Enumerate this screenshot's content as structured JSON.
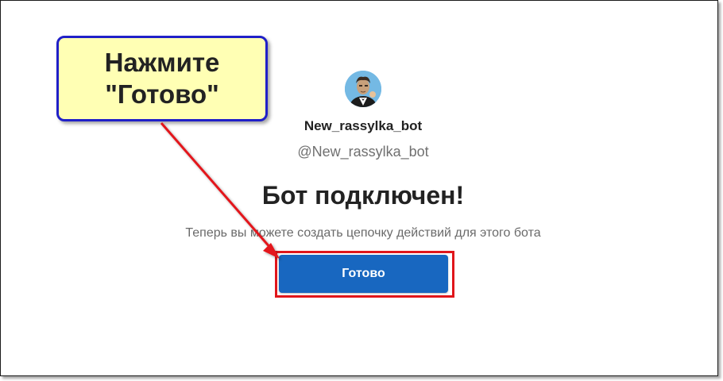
{
  "bot": {
    "avatar": "bot-avatar-icon",
    "name": "New_rassylka_bot",
    "handle": "@New_rassylka_bot"
  },
  "main": {
    "headline": "Бот подключен!",
    "description": "Теперь вы можете создать цепочку действий для этого бота",
    "done_button": "Готово"
  },
  "annotation": {
    "callout_line1": "Нажмите",
    "callout_line2": "\"Готово\"",
    "arrow": "red-arrow-icon",
    "highlight_color": "#e0161b"
  },
  "colors": {
    "accent": "#1867c0",
    "callout_bg": "#ffffb4",
    "callout_border": "#2020c8"
  }
}
